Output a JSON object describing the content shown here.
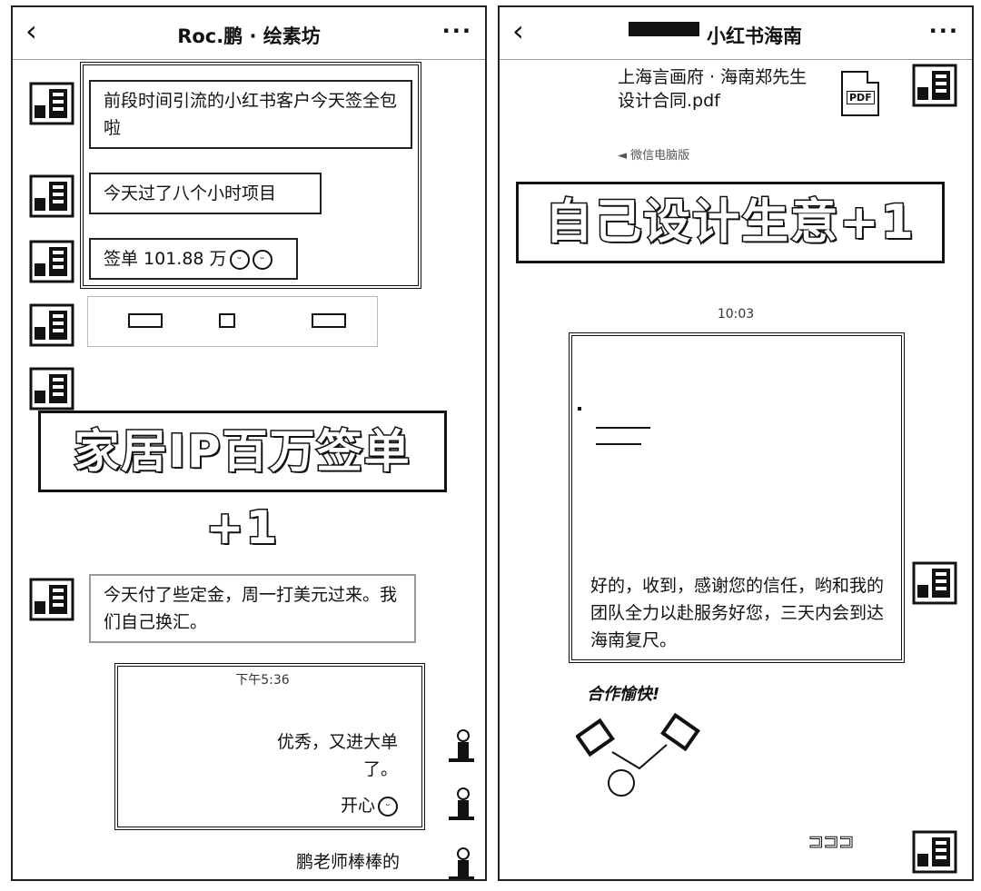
{
  "left_chat": {
    "title": "Roc.鹏 · 绘素坊",
    "back_icon": "chevron-left-icon",
    "more_icon": "more-dots-icon",
    "messages": [
      {
        "text": "前段时间引流的小红书客户今天签全包啦"
      },
      {
        "text": "今天过了八个小时项目"
      },
      {
        "text": "签单 101.88 万"
      }
    ],
    "banner": "家居IP百万签单+1",
    "message_deposit": "今天付了些定金，周一打美元过来。我们自己换汇。",
    "timestamp": "下午5:36",
    "self_messages": [
      {
        "text": "优秀，又进大单了。"
      },
      {
        "text": "开心"
      },
      {
        "text": "鹏老师棒棒的"
      }
    ]
  },
  "right_chat": {
    "title": "小红书海南",
    "back_icon": "chevron-left-icon",
    "more_icon": "more-dots-icon",
    "file": {
      "name": "上海言画府 · 海南郑先生设计合同.pdf",
      "icon": "pdf-file-icon",
      "source": "微信电脑版"
    },
    "banner": "自己设计生意+1",
    "timestamp": "10:03",
    "reply": "好的，收到，感谢您的信任，哟和我的团队全力以赴服务好您，三天内会到达海南复尺。",
    "sticker_caption": "合作愉快!",
    "sticker_icon": "handshake-icon"
  },
  "colors": {
    "ink": "#111111",
    "paper": "#ffffff"
  }
}
